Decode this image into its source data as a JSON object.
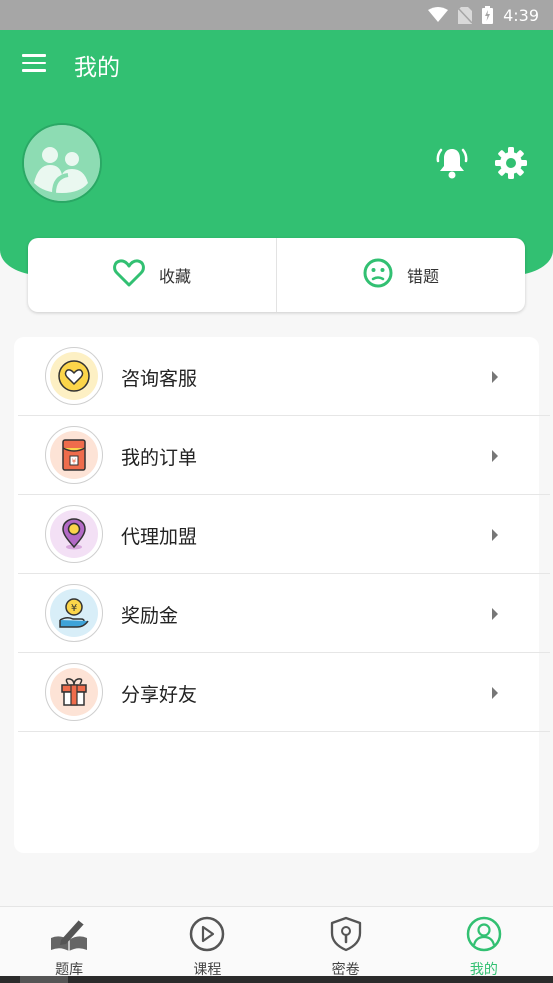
{
  "status_bar": {
    "time": "4:39",
    "icons": [
      "wifi-icon",
      "no-sim-icon",
      "battery-charging-icon"
    ]
  },
  "header": {
    "title": "我的",
    "menu_icon": "hamburger-menu-icon",
    "bell_icon": "bell-ringing-icon",
    "settings_icon": "gear-icon"
  },
  "quick_actions": [
    {
      "label": "收藏",
      "icon": "heart-outline-icon"
    },
    {
      "label": "错题",
      "icon": "sad-face-icon"
    }
  ],
  "menu": [
    {
      "label": "咨询客服",
      "icon": "heart-badge-icon"
    },
    {
      "label": "我的订单",
      "icon": "red-envelope-icon"
    },
    {
      "label": "代理加盟",
      "icon": "location-pin-icon"
    },
    {
      "label": "奖励金",
      "icon": "coin-hand-icon"
    },
    {
      "label": "分享好友",
      "icon": "gift-box-icon"
    }
  ],
  "bottom_nav": [
    {
      "label": "题库",
      "icon": "book-pen-icon",
      "active": false
    },
    {
      "label": "课程",
      "icon": "play-circle-icon",
      "active": false
    },
    {
      "label": "密卷",
      "icon": "shield-lock-icon",
      "active": false
    },
    {
      "label": "我的",
      "icon": "user-circle-icon",
      "active": true
    }
  ],
  "colors": {
    "primary": "#32c072",
    "background": "#f7f7f7",
    "status_bar": "#a6a6a6"
  }
}
